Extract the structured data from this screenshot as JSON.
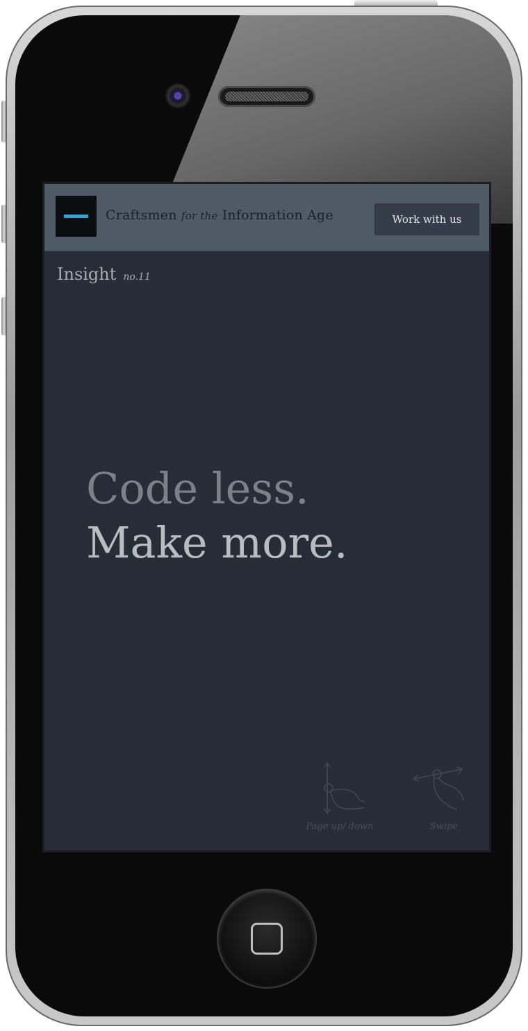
{
  "header": {
    "brand_part1": "Craftsmen",
    "brand_italic": "for the",
    "brand_part2": "Information Age",
    "cta_label": "Work with us"
  },
  "insight": {
    "label": "Insight",
    "issue": "no.11"
  },
  "headline": {
    "line1": "Code less.",
    "line2": "Make more."
  },
  "gestures": {
    "page_updown_label": "Page up/ down",
    "swipe_label": "Swipe"
  },
  "icons": {
    "logo": "logo-dash-icon",
    "page_updown": "hand-vertical-arrows-icon",
    "swipe": "hand-horizontal-arrows-icon",
    "home": "home-button-square-icon"
  },
  "colors": {
    "header_bg": "#4f5a67",
    "screen_bg": "#262d37",
    "accent": "#2fa3dc",
    "cta_bg": "#333c48"
  }
}
